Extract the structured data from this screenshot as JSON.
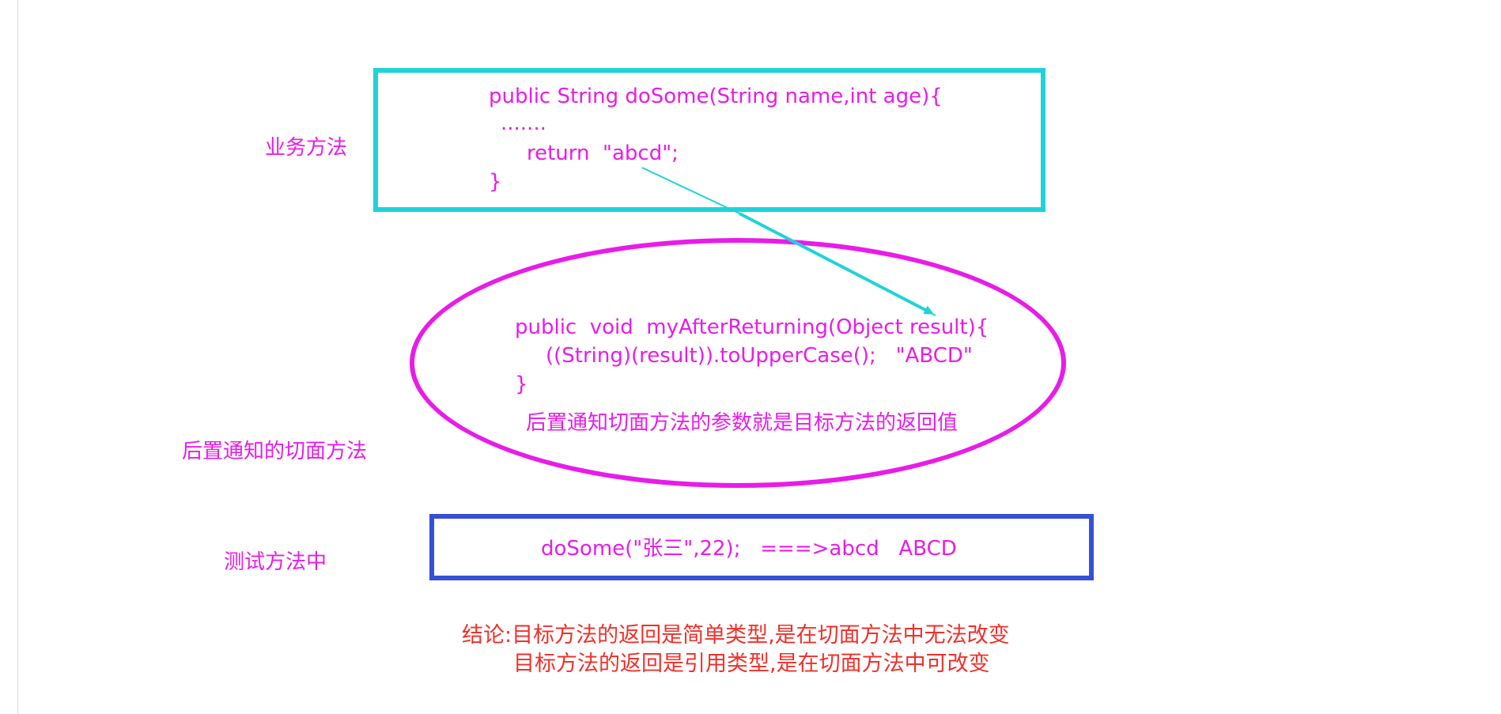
{
  "labels": {
    "business_method": "业务方法",
    "after_returning_aspect": "后置通知的切面方法",
    "in_test_method": "测试方法中"
  },
  "business_code": {
    "line1": "public String doSome(String name,int age){",
    "line2": ".......",
    "line3": "return  \"abcd\";",
    "line4": "}"
  },
  "aspect_code": {
    "line1": "public  void  myAfterReturning(Object result){",
    "line2": "((String)(result)).toUpperCase();   \"ABCD\"",
    "line3": "}",
    "note": "后置通知切面方法的参数就是目标方法的返回值"
  },
  "test_code": {
    "line1": "doSome(\"张三\",22);   ===>abcd   ABCD"
  },
  "conclusion": {
    "line1": "结论:目标方法的返回是简单类型,是在切面方法中无法改变",
    "line2": "目标方法的返回是引用类型,是在切面方法中可改变"
  },
  "colors": {
    "magenta": "#e81ce8",
    "cyan": "#1fd3d8",
    "blue": "#3550d6",
    "red": "#f0302a"
  }
}
